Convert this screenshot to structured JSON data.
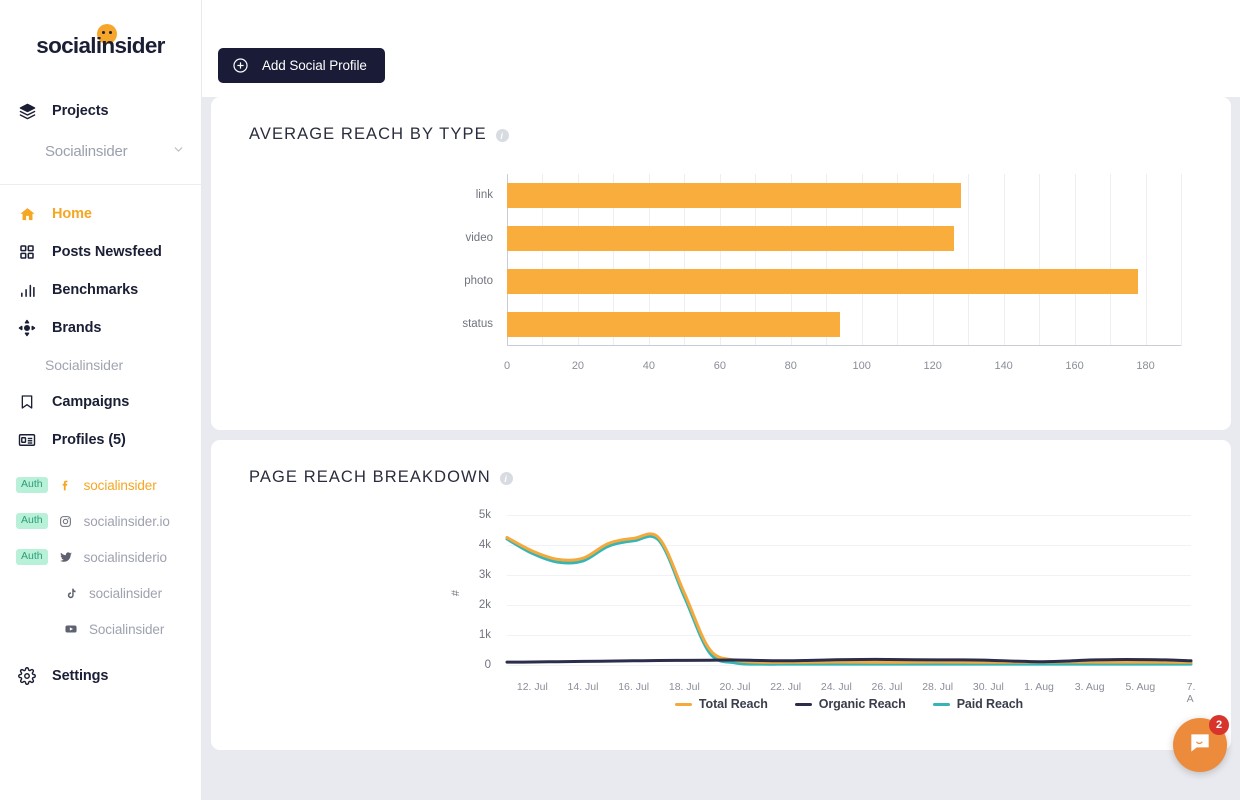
{
  "brand": {
    "logo_text": "socialinsider",
    "accent": "#f5a623",
    "dark": "#191b37"
  },
  "sidebar": {
    "projects_label": "Projects",
    "project_selected": "Socialinsider",
    "nav": [
      {
        "label": "Home",
        "icon": "home-icon",
        "active": true
      },
      {
        "label": "Posts Newsfeed",
        "icon": "grid-icon",
        "active": false
      },
      {
        "label": "Benchmarks",
        "icon": "bar-chart-icon",
        "active": false
      },
      {
        "label": "Brands",
        "icon": "brands-icon",
        "active": false
      }
    ],
    "brand_subtext": "Socialinsider",
    "nav2": [
      {
        "label": "Campaigns",
        "icon": "bookmark-icon"
      },
      {
        "label": "Profiles (5)",
        "icon": "id-card-icon"
      }
    ],
    "auth_label": "Auth",
    "profiles": [
      {
        "name": "socialinsider",
        "network": "facebook-icon",
        "auth": true,
        "highlight": true
      },
      {
        "name": "socialinsider.io",
        "network": "instagram-icon",
        "auth": true,
        "highlight": false
      },
      {
        "name": "socialinsiderio",
        "network": "twitter-icon",
        "auth": true,
        "highlight": false
      },
      {
        "name": "socialinsider",
        "network": "tiktok-icon",
        "auth": false,
        "highlight": false
      },
      {
        "name": "Socialinsider",
        "network": "youtube-icon",
        "auth": false,
        "highlight": false
      }
    ],
    "settings": {
      "label": "Settings",
      "icon": "gear-icon"
    }
  },
  "topbar": {
    "add_profile_label": "Add Social Profile",
    "add_profile_icon": "plus-circle-icon"
  },
  "chat": {
    "icon": "chat-bubble-icon",
    "unread": "2",
    "badge_color": "#d7342b",
    "bubble_color": "#ec8b3c"
  },
  "cards": [
    {
      "title": "AVERAGE REACH BY TYPE",
      "info_icon": "info-icon"
    },
    {
      "title": "PAGE REACH BREAKDOWN",
      "info_icon": "info-icon"
    }
  ],
  "chart_data": [
    {
      "type": "bar",
      "orientation": "horizontal",
      "title": "AVERAGE REACH BY TYPE",
      "categories": [
        "link",
        "video",
        "photo",
        "status"
      ],
      "values": [
        128,
        126,
        178,
        94
      ],
      "xlabel": "",
      "ylabel": "",
      "xlim": [
        0,
        190
      ],
      "xticks": [
        0,
        20,
        40,
        60,
        80,
        100,
        120,
        140,
        160,
        180
      ],
      "xtick_labels": [
        "0",
        "20",
        "40",
        "60",
        "80",
        "100",
        "120",
        "140",
        "160",
        "180"
      ],
      "color": "#f8ad3c",
      "grid": "vertical-minor-every-10",
      "legend": "none"
    },
    {
      "type": "line",
      "title": "PAGE REACH BREAKDOWN",
      "xlabel": "",
      "ylabel": "#",
      "ylim": [
        0,
        5000
      ],
      "yticks": [
        0,
        1000,
        2000,
        3000,
        4000,
        5000
      ],
      "ytick_labels": [
        "0",
        "1k",
        "2k",
        "3k",
        "4k",
        "5k"
      ],
      "x": [
        "11. Jul",
        "12. Jul",
        "13. Jul",
        "14. Jul",
        "15. Jul",
        "16. Jul",
        "17. Jul",
        "18. Jul",
        "19. Jul",
        "20. Jul",
        "21. Jul",
        "22. Jul",
        "23. Jul",
        "24. Jul",
        "25. Jul",
        "26. Jul",
        "27. Jul",
        "28. Jul",
        "29. Jul",
        "30. Jul",
        "31. Jul",
        "1. Aug",
        "2. Aug",
        "3. Aug",
        "4. Aug",
        "5. Aug",
        "6. Aug",
        "7. Aug"
      ],
      "xtick_labels": [
        "12. Jul",
        "14. Jul",
        "16. Jul",
        "18. Jul",
        "20. Jul",
        "22. Jul",
        "24. Jul",
        "26. Jul",
        "28. Jul",
        "30. Jul",
        "1. Aug",
        "3. Aug",
        "5. Aug",
        "7. A"
      ],
      "legend_position": "bottom",
      "grid": "horizontal",
      "series": [
        {
          "name": "Total Reach",
          "color": "#f5a93c",
          "values": [
            4250,
            3800,
            3520,
            3560,
            4050,
            4220,
            4230,
            2400,
            520,
            160,
            95,
            90,
            95,
            100,
            95,
            90,
            95,
            100,
            95,
            90,
            95,
            100,
            105,
            100,
            95,
            95,
            95,
            90
          ]
        },
        {
          "name": "Organic Reach",
          "color": "#2b2d4a",
          "values": [
            95,
            100,
            110,
            120,
            130,
            140,
            150,
            155,
            160,
            165,
            150,
            140,
            155,
            175,
            185,
            185,
            175,
            170,
            170,
            160,
            130,
            110,
            130,
            165,
            180,
            180,
            170,
            140
          ]
        },
        {
          "name": "Paid Reach",
          "color": "#35b5b5",
          "values": [
            4200,
            3720,
            3430,
            3470,
            3960,
            4140,
            4150,
            2280,
            400,
            70,
            30,
            28,
            30,
            30,
            28,
            28,
            30,
            30,
            28,
            28,
            30,
            30,
            30,
            28,
            28,
            30,
            30,
            28
          ]
        }
      ]
    }
  ]
}
